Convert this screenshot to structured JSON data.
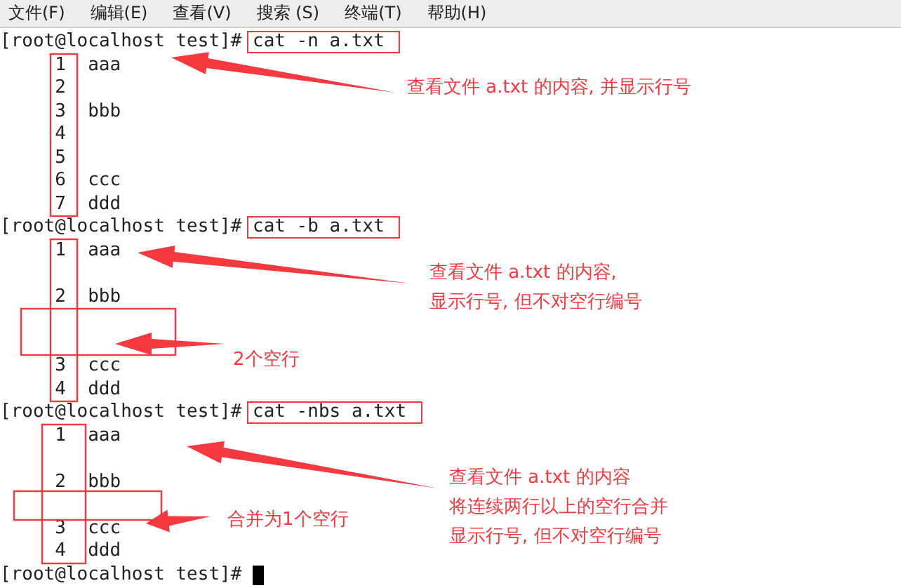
{
  "menu": [
    "文件(F)",
    "编辑(E)",
    "查看(V)",
    "搜索 (S)",
    "终端(T)",
    "帮助(H)"
  ],
  "terminal": {
    "lines": [
      {
        "kind": "prompt",
        "prompt": "[root@localhost test]#",
        "command": "cat -n a.txt"
      },
      {
        "kind": "numbered",
        "number": "1",
        "text": "aaa"
      },
      {
        "kind": "numbered",
        "number": "2"
      },
      {
        "kind": "numbered",
        "number": "3",
        "text": "bbb"
      },
      {
        "kind": "numbered",
        "number": "4"
      },
      {
        "kind": "numbered",
        "number": "5"
      },
      {
        "kind": "numbered",
        "number": "6",
        "text": "ccc"
      },
      {
        "kind": "numbered",
        "number": "7",
        "text": "ddd"
      },
      {
        "kind": "prompt",
        "prompt": "[root@localhost test]#",
        "command": "cat -b a.txt"
      },
      {
        "kind": "numbered",
        "number": "1",
        "text": "aaa"
      },
      {
        "kind": "blank"
      },
      {
        "kind": "numbered",
        "number": "2",
        "text": "bbb"
      },
      {
        "kind": "blank"
      },
      {
        "kind": "blank"
      },
      {
        "kind": "numbered",
        "number": "3",
        "text": "ccc"
      },
      {
        "kind": "numbered",
        "number": "4",
        "text": "ddd"
      },
      {
        "kind": "prompt",
        "prompt": "[root@localhost test]#",
        "command": "cat -nbs a.txt"
      },
      {
        "kind": "numbered",
        "number": "1",
        "text": "aaa"
      },
      {
        "kind": "blank"
      },
      {
        "kind": "numbered",
        "number": "2",
        "text": "bbb"
      },
      {
        "kind": "blank"
      },
      {
        "kind": "numbered",
        "number": "3",
        "text": "ccc"
      },
      {
        "kind": "numbered",
        "number": "4",
        "text": "ddd"
      },
      {
        "kind": "cursor",
        "prompt": "[root@localhost test]#"
      }
    ]
  },
  "annotations": [
    {
      "lines": [
        "查看文件 a.txt 的内容, 并显示行号"
      ]
    },
    {
      "lines": [
        "查看文件 a.txt 的内容,",
        "显示行号, 但不对空行编号"
      ]
    },
    {
      "lines": [
        "2个空行"
      ]
    },
    {
      "lines": [
        "查看文件 a.txt 的内容",
        "将连续两行以上的空行合并",
        "显示行号, 但不对空行编号"
      ]
    },
    {
      "lines": [
        "合并为1个空行"
      ]
    }
  ]
}
